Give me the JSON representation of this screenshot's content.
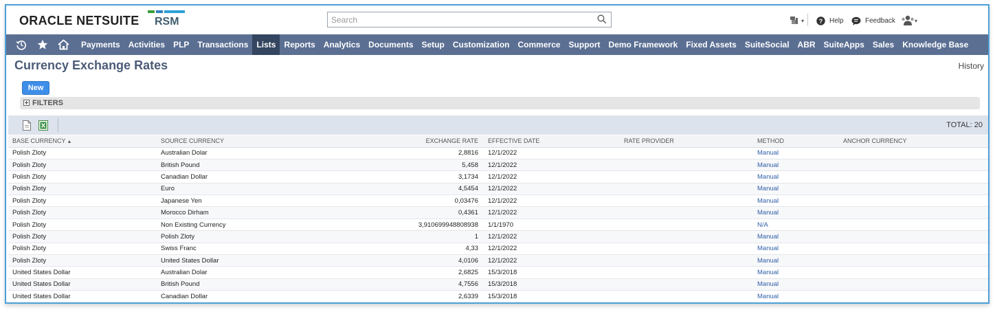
{
  "header": {
    "logo_oracle_bold": "ORACLE",
    "logo_netsuite": "NETSUITE",
    "partner_logo": "RSM",
    "search_placeholder": "Search",
    "help_label": "Help",
    "feedback_label": "Feedback"
  },
  "colors": {
    "nav_bg": "#5b6f93",
    "nav_active": "#34455f",
    "title": "#4b5b77",
    "new_button": "#3f8fea",
    "link": "#2f5fa8",
    "frame_border": "#4a9fd8"
  },
  "nav": {
    "icons": [
      "recent-history-icon",
      "star-icon",
      "home-icon"
    ],
    "items": [
      {
        "label": "Payments"
      },
      {
        "label": "Activities"
      },
      {
        "label": "PLP"
      },
      {
        "label": "Transactions"
      },
      {
        "label": "Lists",
        "active": true
      },
      {
        "label": "Reports"
      },
      {
        "label": "Analytics"
      },
      {
        "label": "Documents"
      },
      {
        "label": "Setup"
      },
      {
        "label": "Customization"
      },
      {
        "label": "Commerce"
      },
      {
        "label": "Support"
      },
      {
        "label": "Demo Framework"
      },
      {
        "label": "Fixed Assets"
      },
      {
        "label": "SuiteSocial"
      },
      {
        "label": "ABR"
      },
      {
        "label": "SuiteApps"
      },
      {
        "label": "Sales"
      },
      {
        "label": "Knowledge Base"
      }
    ]
  },
  "page": {
    "title": "Currency Exchange Rates",
    "history_link": "History",
    "new_button": "New",
    "filters_label": "FILTERS",
    "total_label": "TOTAL: 20"
  },
  "table": {
    "columns": [
      "BASE CURRENCY",
      "SOURCE CURRENCY",
      "EXCHANGE RATE",
      "EFFECTIVE DATE",
      "RATE PROVIDER",
      "METHOD",
      "ANCHOR CURRENCY"
    ],
    "sort_indicator": "▲",
    "rows": [
      [
        "Polish Zloty",
        "Australian Dolar",
        "2,8816",
        "12/1/2022",
        "",
        "Manual",
        ""
      ],
      [
        "Polish Zloty",
        "British Pound",
        "5,458",
        "12/1/2022",
        "",
        "Manual",
        ""
      ],
      [
        "Polish Zloty",
        "Canadian Dollar",
        "3,1734",
        "12/1/2022",
        "",
        "Manual",
        ""
      ],
      [
        "Polish Zloty",
        "Euro",
        "4,5454",
        "12/1/2022",
        "",
        "Manual",
        ""
      ],
      [
        "Polish Zloty",
        "Japanese Yen",
        "0,03476",
        "12/1/2022",
        "",
        "Manual",
        ""
      ],
      [
        "Polish Zloty",
        "Morocco Dirham",
        "0,4361",
        "12/1/2022",
        "",
        "Manual",
        ""
      ],
      [
        "Polish Zloty",
        "Non Existing Currency",
        "3,910699948808938",
        "1/1/1970",
        "",
        "N/A",
        ""
      ],
      [
        "Polish Zloty",
        "Polish Zloty",
        "1",
        "12/1/2022",
        "",
        "Manual",
        ""
      ],
      [
        "Polish Zloty",
        "Swiss Franc",
        "4,33",
        "12/1/2022",
        "",
        "Manual",
        ""
      ],
      [
        "Polish Zloty",
        "United States Dollar",
        "4,0106",
        "12/1/2022",
        "",
        "Manual",
        ""
      ],
      [
        "United States Dollar",
        "Australian Dolar",
        "2,6825",
        "15/3/2018",
        "",
        "Manual",
        ""
      ],
      [
        "United States Dollar",
        "British Pound",
        "4,7556",
        "15/3/2018",
        "",
        "Manual",
        ""
      ],
      [
        "United States Dollar",
        "Canadian Dollar",
        "2,6339",
        "15/3/2018",
        "",
        "Manual",
        ""
      ]
    ]
  }
}
